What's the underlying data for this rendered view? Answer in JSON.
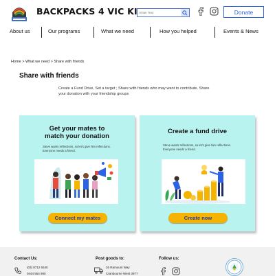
{
  "brand": {
    "name": "BACKPACKS 4 VIC KIDS",
    "logo_icon": "backpack-logo-icon"
  },
  "search": {
    "placeholder": "Enter Text",
    "icon": "search-icon"
  },
  "social": {
    "facebook_icon": "facebook-icon",
    "instagram_icon": "instagram-icon"
  },
  "header": {
    "donate_label": "Donate"
  },
  "nav": {
    "items": [
      {
        "label": "About us"
      },
      {
        "label": "Our programs"
      },
      {
        "label": "What we need"
      },
      {
        "label": "How you helped"
      },
      {
        "label": "Events & News"
      }
    ]
  },
  "breadcrumb": "Home > What we need > Share with friends",
  "page": {
    "title": "Share with friends",
    "intro": "Create a Fund Drive, Set a target ; Share with friends who may want to contribute. Share your donation with your friendship groups"
  },
  "cards": [
    {
      "title_line1": "Get your mates to",
      "title_line2": "match your donation",
      "text_line1": "Steve wants reflections, so let's give him reflections.",
      "text_line2": "Everyone needs a friend.",
      "button": "Connect my mates",
      "image_icon": "friends-megaphone-illustration"
    },
    {
      "title": "Create a fund drive",
      "text_line1": "Steve wants reflections, so let's give him reflections.",
      "text_line2": "Everyone needs a friend.",
      "button": "Create now",
      "image_icon": "fund-drive-coins-illustration"
    }
  ],
  "footer": {
    "contact": {
      "heading": "Contact Us:",
      "phone1": "(03) 8712 5545",
      "phone2": "0444 554 980",
      "icon": "phone-icon"
    },
    "post": {
      "heading": "Post goods to:",
      "line1": "26 Ramount Way",
      "line2": "Cranbourne West 3977",
      "icon": "truck-icon"
    },
    "follow": {
      "heading": "Follow us:"
    },
    "seal_icon": "charity-seal-icon"
  },
  "colors": {
    "accent_blue": "#2c62e6",
    "card_bg": "#b9f3f0",
    "button_yellow": "#f4b400",
    "button_text": "#2a3a9e",
    "footer_bg": "#f1f1f1"
  }
}
